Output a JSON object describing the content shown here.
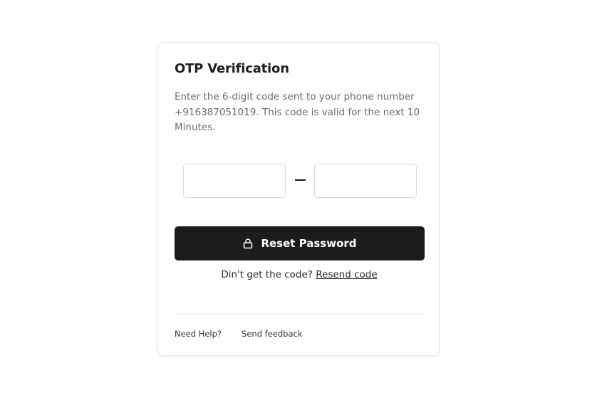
{
  "card": {
    "title": "OTP Verification",
    "description": "Enter the 6-digit code sent to your phone number +916387051019. This code is valid for the next 10 Minutes."
  },
  "otp": {
    "digits": [
      "",
      "",
      "",
      "",
      "",
      ""
    ],
    "separator": "—"
  },
  "reset_button": {
    "label": "Reset Password",
    "icon": "lock-icon"
  },
  "resend": {
    "prompt": "Din't get the code?",
    "link_label": "Resend code"
  },
  "footer": {
    "help_label": "Need Help?",
    "feedback_label": "Send feedback"
  },
  "colors": {
    "button_bg": "#1c1c1c",
    "button_text": "#ffffff",
    "description_text": "#6b6b6b",
    "border": "#d9d9d9"
  }
}
